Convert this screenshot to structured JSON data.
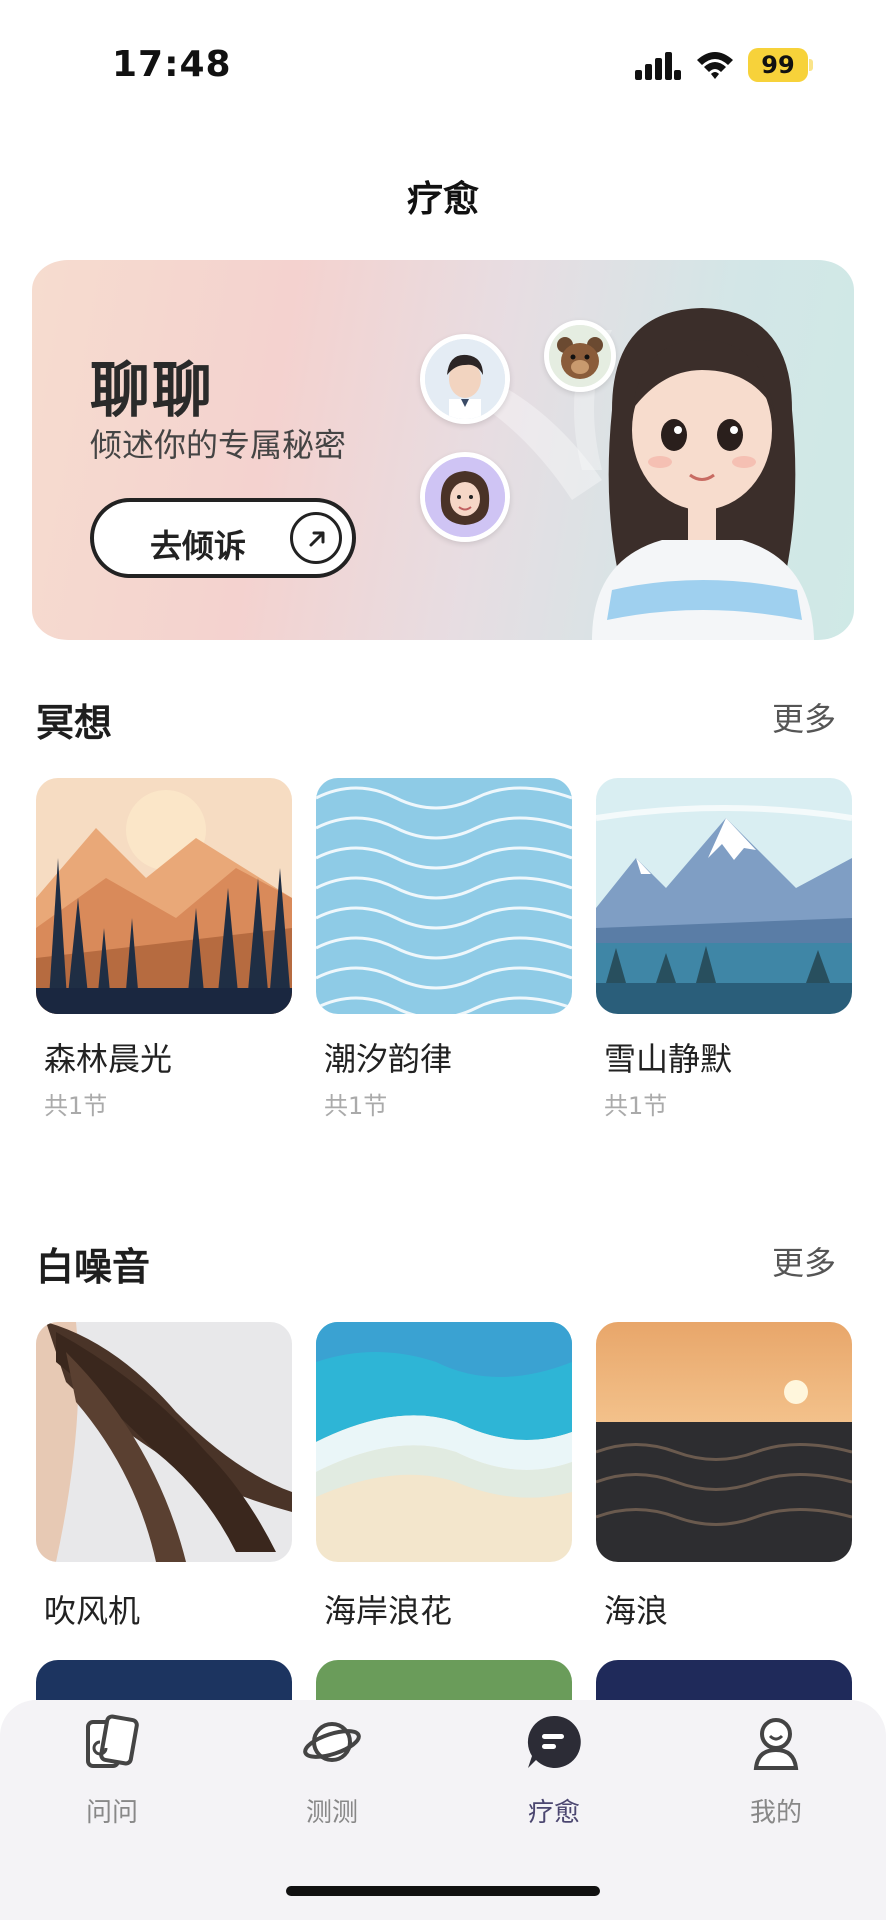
{
  "status_bar": {
    "time": "17:48",
    "battery": "99"
  },
  "page": {
    "title": "疗愈"
  },
  "banner": {
    "heading": "聊聊",
    "subtitle": "倾述你的专属秘密",
    "cta_label": "去倾诉"
  },
  "meditation": {
    "title": "冥想",
    "more": "更多",
    "items": [
      {
        "name": "森林晨光",
        "meta": "共1节"
      },
      {
        "name": "潮汐韵律",
        "meta": "共1节"
      },
      {
        "name": "雪山静默",
        "meta": "共1节"
      }
    ]
  },
  "white_noise": {
    "title": "白噪音",
    "more": "更多",
    "items": [
      {
        "name": "吹风机"
      },
      {
        "name": "海岸浪花"
      },
      {
        "name": "海浪"
      }
    ]
  },
  "nav": {
    "items": [
      {
        "label": "问问",
        "icon": "cards-icon"
      },
      {
        "label": "测测",
        "icon": "planet-icon"
      },
      {
        "label": "疗愈",
        "icon": "chat-bubble-icon",
        "active": true
      },
      {
        "label": "我的",
        "icon": "profile-icon"
      }
    ]
  },
  "colors": {
    "accent": "#4b4670",
    "battery": "#f7d23a"
  }
}
